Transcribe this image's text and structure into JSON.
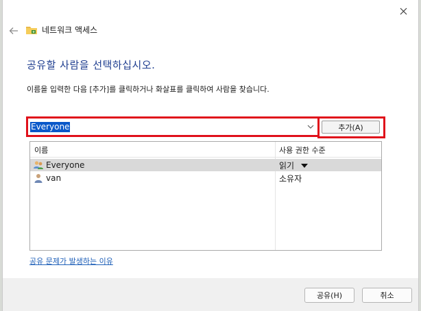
{
  "window": {
    "title": "네트워크 액세스"
  },
  "heading": "공유할 사람을 선택하십시오.",
  "instruction": "이름을 입력한 다음 [추가]를 클릭하거나 화살표를 클릭하여 사람을 찾습니다.",
  "combo": {
    "value": "Everyone"
  },
  "add_button": {
    "label": "추가(A)"
  },
  "table": {
    "columns": [
      "이름",
      "사용 권한 수준"
    ],
    "rows": [
      {
        "name": "Everyone",
        "permission": "읽기",
        "icon": "group-users-icon",
        "selected": true,
        "has_dropdown": true
      },
      {
        "name": "van",
        "permission": "소유자",
        "icon": "user-icon",
        "selected": false,
        "has_dropdown": false
      }
    ]
  },
  "help_link": "공유 문제가 발생하는 이유",
  "footer": {
    "share_label": "공유(H)",
    "cancel_label": "취소"
  },
  "colors": {
    "heading": "#1e3d8f",
    "link": "#1e5fb8",
    "highlight_outline": "#e0101a",
    "selection": "#0a58c9"
  }
}
